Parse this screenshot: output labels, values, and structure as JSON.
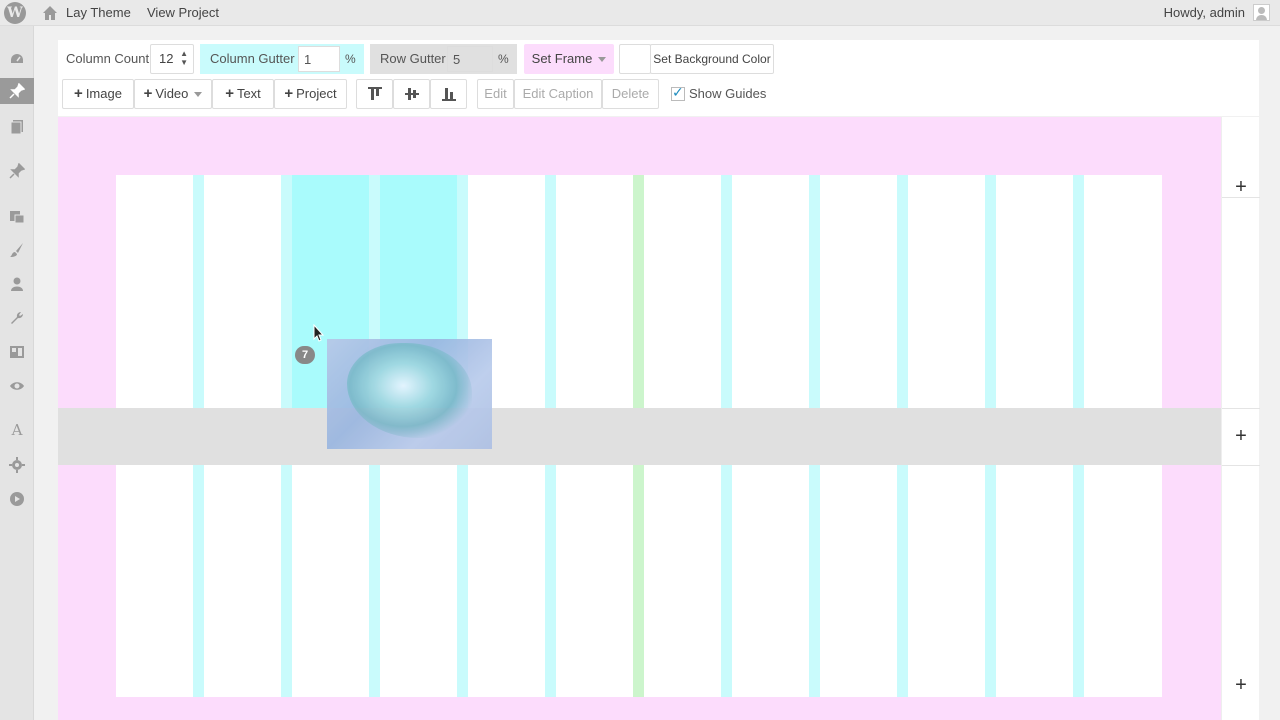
{
  "adminbar": {
    "site_name": "Lay Theme",
    "view_link": "View Project",
    "greeting": "Howdy, admin"
  },
  "sidebar": {
    "items": [
      {
        "icon": "dashboard-icon",
        "active": false
      },
      {
        "icon": "pin-icon",
        "active": true
      },
      {
        "icon": "pages-icon",
        "active": false
      },
      {
        "icon": "pin-icon",
        "active": false
      },
      {
        "icon": "media-icon",
        "active": false
      },
      {
        "icon": "brush-icon",
        "active": false
      },
      {
        "icon": "user-icon",
        "active": false
      },
      {
        "icon": "wrench-icon",
        "active": false
      },
      {
        "icon": "layout-icon",
        "active": false
      },
      {
        "icon": "eye-icon",
        "active": false
      },
      {
        "icon": "font-icon",
        "active": false
      },
      {
        "icon": "gear-icon",
        "active": false
      },
      {
        "icon": "play-icon",
        "active": false
      }
    ]
  },
  "toolbar": {
    "column_count_label": "Column Count",
    "column_count_value": "12",
    "column_gutter_label": "Column Gutter",
    "column_gutter_value": "1",
    "row_gutter_label": "Row Gutter",
    "row_gutter_value": "5",
    "percent": "%",
    "set_frame": "Set Frame",
    "set_background": "Set Background Color",
    "add_image": "Image",
    "add_video": "Video",
    "add_text": "Text",
    "add_project": "Project",
    "edit": "Edit",
    "edit_caption": "Edit Caption",
    "delete": "Delete",
    "show_guides": "Show Guides",
    "show_guides_checked": true,
    "colors": {
      "column_gutter_bg": "#c9fbfc",
      "row_gutter_bg": "#e0e0e0",
      "set_frame_bg": "#fcdcfc"
    }
  },
  "grid": {
    "colors": {
      "frame": "#fcdcfc",
      "gutter": "#c9fbfc",
      "center_gutter": "#ccf5cc",
      "highlight": "#a9fbfc",
      "row_gutter": "#e0e0e0"
    },
    "drag_badge": "7"
  },
  "rightcol": {
    "add_symbol": "+"
  }
}
